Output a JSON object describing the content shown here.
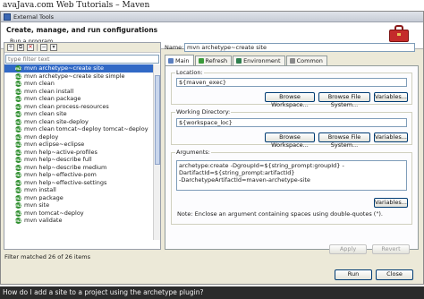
{
  "page": {
    "header": "avaJava.com Web Tutorials – Maven"
  },
  "window": {
    "title": "External Tools"
  },
  "banner": {
    "title": "Create, manage, and run configurations",
    "subtitle": "Run a program",
    "icon": "toolbox-icon"
  },
  "left": {
    "toolbar_icons": [
      "new-config-icon",
      "duplicate-icon",
      "delete-icon",
      "collapse-icon",
      "filter-icon"
    ],
    "filter_placeholder": "type filter text",
    "items": [
      "mvn archetype~create site",
      "mvn archetype~create site simple",
      "mvn clean",
      "mvn clean install",
      "mvn clean package",
      "mvn clean process-resources",
      "mvn clean site",
      "mvn clean site-deploy",
      "mvn clean tomcat~deploy tomcat~deploy",
      "mvn deploy",
      "mvn eclipse~eclipse",
      "mvn help~active-profiles",
      "mvn help~describe full",
      "mvn help~describe medium",
      "mvn help~effective-pom",
      "mvn help~effective-settings",
      "mvn install",
      "mvn package",
      "mvn site",
      "mvn tomcat~deploy",
      "mvn validate"
    ],
    "selected_index": 0,
    "status": "Filter matched 26 of 26 items"
  },
  "right": {
    "name_label": "Name:",
    "name_value": "mvn archetype~create site",
    "tabs": [
      "Main",
      "Refresh",
      "Environment",
      "Common"
    ],
    "active_tab": "Main",
    "location": {
      "label": "Location:",
      "value": "${maven_exec}"
    },
    "working_dir": {
      "label": "Working Directory:",
      "value": "${workspace_loc}"
    },
    "arguments": {
      "label": "Arguments:",
      "line1": "archetype:create -DgroupId=${string_prompt:groupId} -DartifactId=${string_prompt:artifactId}",
      "line2": "-DarchetypeArtifactId=maven-archetype-site"
    },
    "buttons": {
      "browse_workspace": "Browse Workspace...",
      "browse_fs": "Browse File System...",
      "variables": "Variables..."
    },
    "note": "Note: Enclose an argument containing spaces using double-quotes (\").",
    "apply": "Apply",
    "revert": "Revert"
  },
  "footer": {
    "run": "Run",
    "close": "Close"
  },
  "caption": "How do I add a site to a project using the archetype plugin?"
}
